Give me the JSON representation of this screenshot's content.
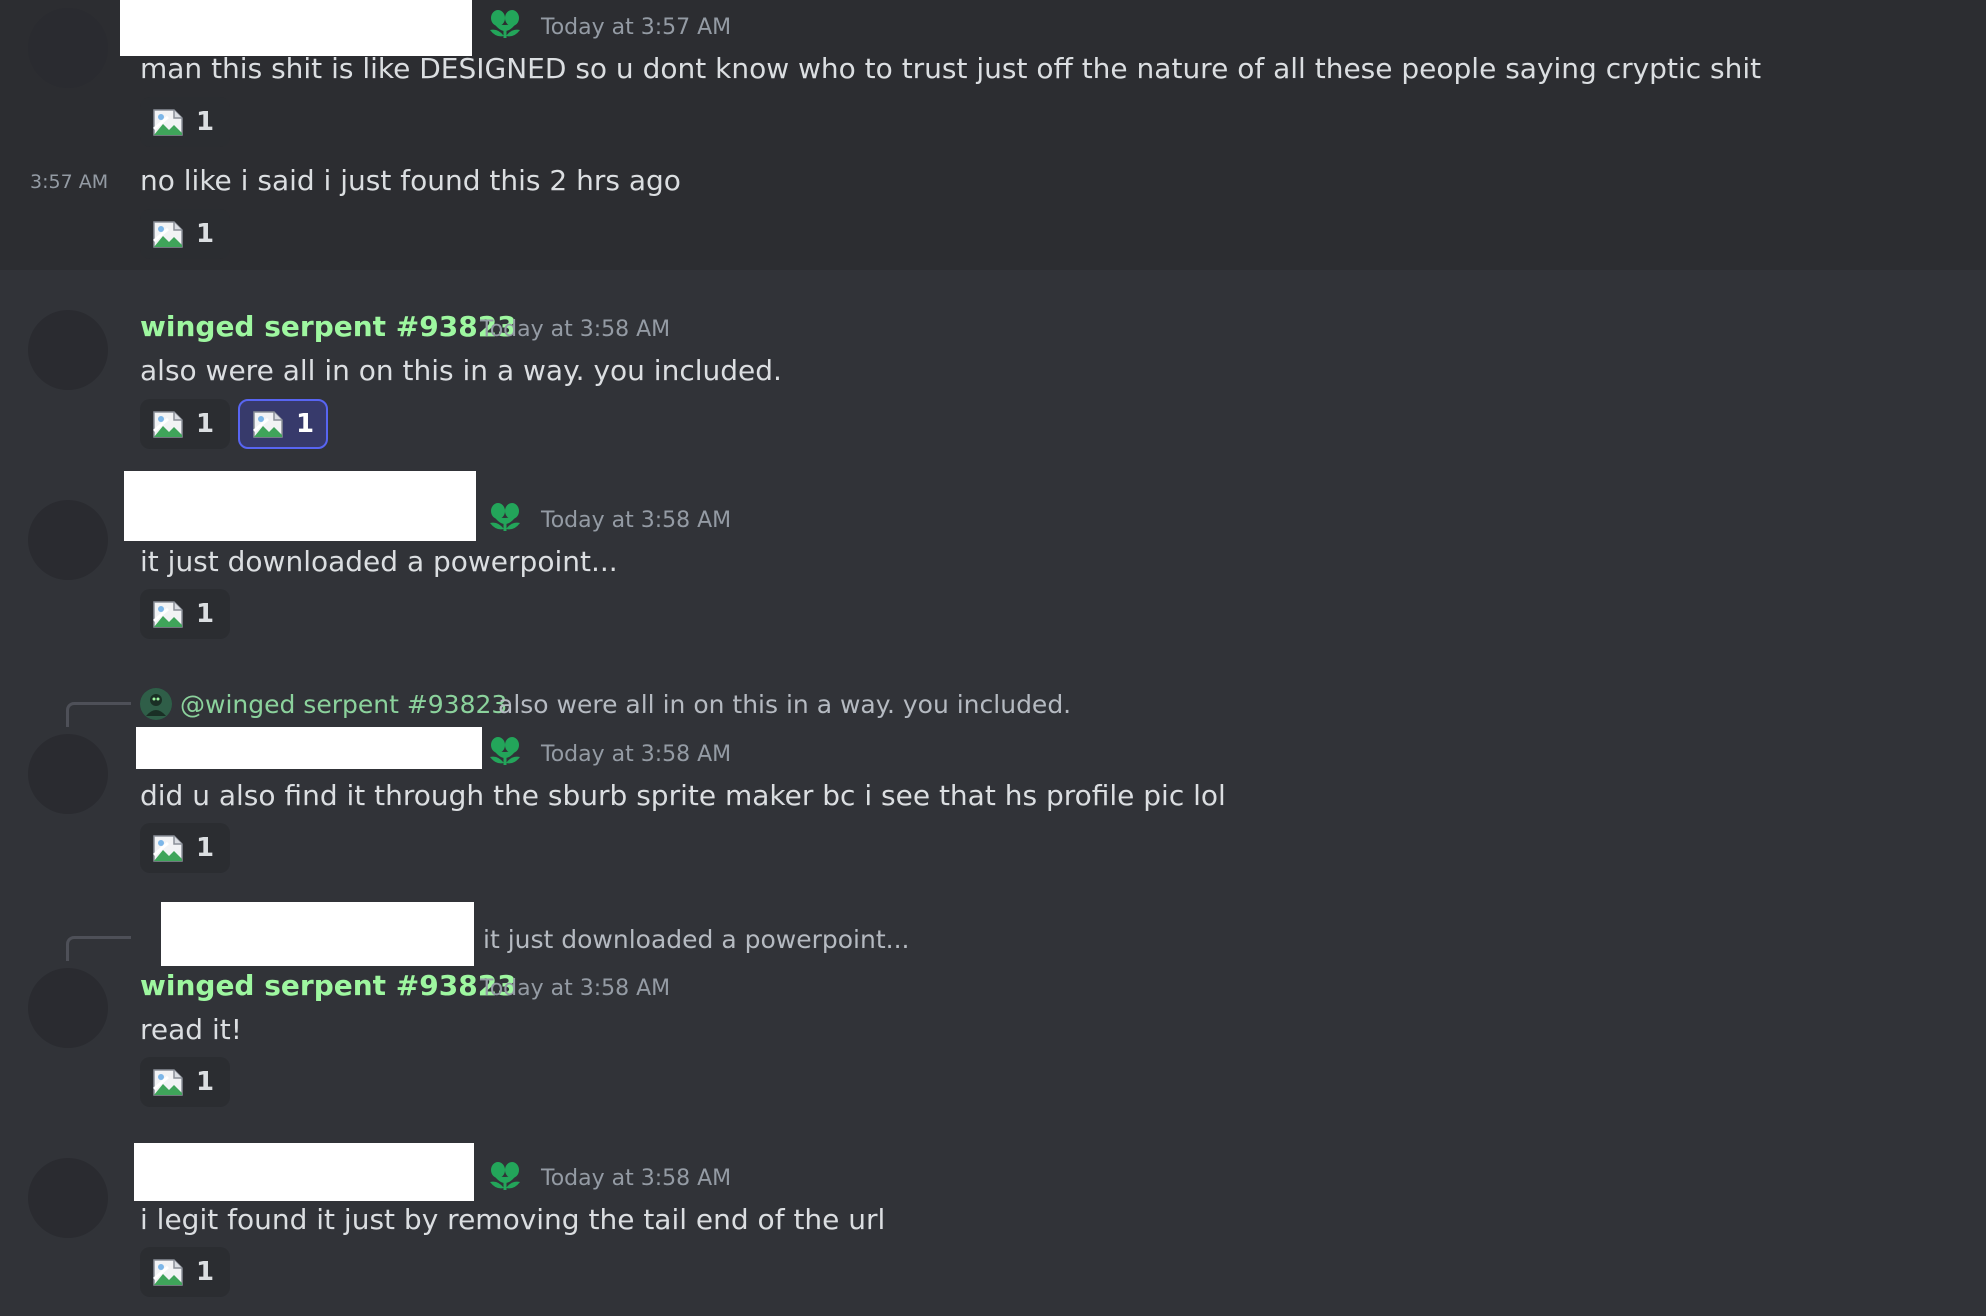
{
  "messages": [
    {
      "header_timestamp": "Today at 3:57 AM",
      "text": "man this shit is like DESIGNED so u dont know who to trust just off the nature of all these people saying cryptic shit",
      "reactions": [
        {
          "count": "1"
        }
      ]
    },
    {
      "side_timestamp": "3:57 AM",
      "text": "no like i said i just found this 2 hrs ago",
      "reactions": [
        {
          "count": "1"
        }
      ]
    },
    {
      "username": "winged serpent #93823",
      "header_timestamp": "Today at 3:58 AM",
      "text": "also were all in on this in a way. you included.",
      "reactions": [
        {
          "count": "1"
        },
        {
          "count": "1"
        }
      ]
    },
    {
      "header_timestamp": "Today at 3:58 AM",
      "text": "it just downloaded a powerpoint...",
      "reactions": [
        {
          "count": "1"
        }
      ]
    },
    {
      "reply_to_name": "@winged serpent #93823",
      "reply_to_text": "also were all in on this in a way. you included.",
      "header_timestamp": "Today at 3:58 AM",
      "text": "did u also find it through the sburb sprite maker bc i see that hs profile pic lol",
      "reactions": [
        {
          "count": "1"
        }
      ]
    },
    {
      "reply_to_text": "it just downloaded a powerpoint...",
      "username": "winged serpent #93823",
      "header_timestamp": "Today at 3:58 AM",
      "text": "read it!",
      "reactions": [
        {
          "count": "1"
        }
      ]
    },
    {
      "header_timestamp": "Today at 3:58 AM",
      "text": "i legit found it just by removing the tail end of the url",
      "reactions": [
        {
          "count": "1"
        }
      ]
    }
  ],
  "colors": {
    "background": "#313338",
    "username": "#9ef7a0",
    "timestamp": "#949ba4",
    "message_text": "#dbdee1",
    "role_icon": "#23a55a",
    "active_reaction_border": "#5865f2"
  },
  "icons": {
    "role_badge": "flower-icon",
    "reaction_emoji": "broken-image-icon"
  }
}
